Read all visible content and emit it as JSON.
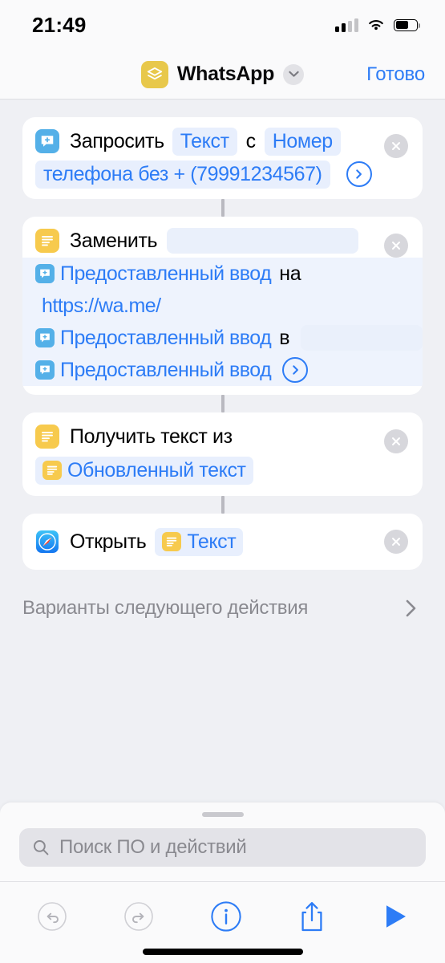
{
  "status_bar": {
    "time": "21:49",
    "signal_icon": "cellular-signal-icon",
    "wifi_icon": "wifi-icon",
    "battery_icon": "battery-icon",
    "battery_level": 62
  },
  "nav_bar": {
    "shortcut_icon": "shortcuts-layers-icon",
    "title": "WhatsApp",
    "chevron_icon": "chevron-down-icon",
    "done_label": "Готово"
  },
  "colors": {
    "accent_blue": "#2d7cf6",
    "token_bg": "#e8effd",
    "page_bg": "#eff0f4",
    "card_bg": "#ffffff",
    "icon_yellow": "#f7ca4d",
    "icon_blue": "#54b0e8",
    "muted_text": "#8a8a90"
  },
  "actions": [
    {
      "id": "ask-for-input",
      "icon": "ask-input-bubble-icon",
      "icon_kind": "bubble",
      "title": "Запросить",
      "type_token": "Текст",
      "joiner": "с",
      "prompt_line1": "Номер",
      "prompt_line2": "телефона без + (79991234567)",
      "has_close": true,
      "has_expand_arrow": true
    },
    {
      "id": "replace-text",
      "icon": "text-lines-icon",
      "icon_kind": "text",
      "title": "Заменить",
      "empty_field_after_title": true,
      "has_close": true,
      "rows": [
        {
          "variable": "Предоставленный ввод",
          "var_icon": "ask-input-bubble-icon",
          "after": "на",
          "trailing_field": false
        },
        {
          "variable": "https://wa.me/",
          "var_icon": null,
          "after": "",
          "trailing_field": false
        },
        {
          "variable": "Предоставленный ввод",
          "var_icon": "ask-input-bubble-icon",
          "after": "в",
          "trailing_field": true
        },
        {
          "variable": "Предоставленный ввод",
          "var_icon": "ask-input-bubble-icon",
          "after": "",
          "trailing_field": false,
          "has_expand_arrow": true
        }
      ]
    },
    {
      "id": "get-text-from",
      "icon": "text-lines-icon",
      "icon_kind": "text",
      "title": "Получить текст из",
      "variable": "Обновленный текст",
      "var_icon": "text-lines-icon",
      "has_close": true
    },
    {
      "id": "open-url",
      "icon": "safari-compass-icon",
      "icon_kind": "safari",
      "title": "Открыть",
      "variable": "Текст",
      "var_icon": "text-lines-icon",
      "has_close": true
    }
  ],
  "next_action": {
    "label": "Варианты следующего действия",
    "chevron_icon": "chevron-right-icon"
  },
  "bottom_panel": {
    "grabber": "sheet-grabber-handle",
    "search_placeholder": "Поиск ПО и действий",
    "search_icon": "search-icon",
    "toolbar": [
      {
        "name": "undo-button",
        "icon": "undo-icon",
        "enabled": false
      },
      {
        "name": "redo-button",
        "icon": "redo-icon",
        "enabled": false
      },
      {
        "name": "info-button",
        "icon": "info-icon",
        "enabled": true
      },
      {
        "name": "share-button",
        "icon": "share-icon",
        "enabled": true
      },
      {
        "name": "run-button",
        "icon": "play-icon",
        "enabled": true
      }
    ]
  }
}
